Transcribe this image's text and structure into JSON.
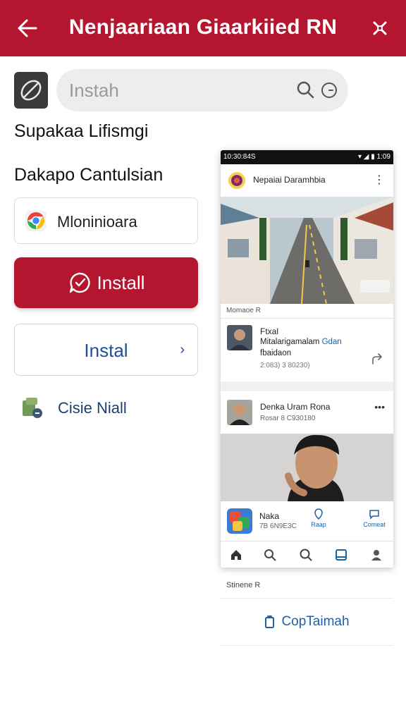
{
  "topbar": {
    "title": "Nenjaariaan Giaarkiied RN"
  },
  "search": {
    "placeholder": "Instah"
  },
  "section": {
    "heading1": "Supakaa Lifismgi",
    "heading2": "Dakapo Cantulsian"
  },
  "app_card": {
    "label": "Mloninioara"
  },
  "buttons": {
    "install_label": "Install",
    "instal_label": "Instal",
    "close_label": "Cisie Niall"
  },
  "phone": {
    "status_time": "10:30:84S",
    "status_right": "1:09",
    "header_name": "Nepaiai Daramhbia",
    "image_caption": "Momaoe R",
    "post1": {
      "name": "Ftxal",
      "line1": "Mitalarigamalam",
      "line1_link": "Gdan",
      "line2": "fbaidaon",
      "meta": "2:083) 3 80230)"
    },
    "post2": {
      "name": "Denka Uram Rona",
      "meta": "Rosar 8 C930180"
    },
    "app_row": {
      "name": "Naka",
      "meta": "7B 6N9E3C",
      "action1": "Raap",
      "action2": "Comeat"
    }
  },
  "below": {
    "label": "Stinene R",
    "copy_label": "CopTaimah"
  },
  "colors": {
    "brand": "#b5162f",
    "link": "#1d5fa8"
  },
  "icons": [
    "back-arrow-icon",
    "tools-icon",
    "pen-icon",
    "search-icon",
    "clock-icon",
    "chrome-icon",
    "install-icon",
    "chevron-right-icon",
    "app-stack-icon",
    "share-icon",
    "home-icon",
    "copy-icon"
  ]
}
